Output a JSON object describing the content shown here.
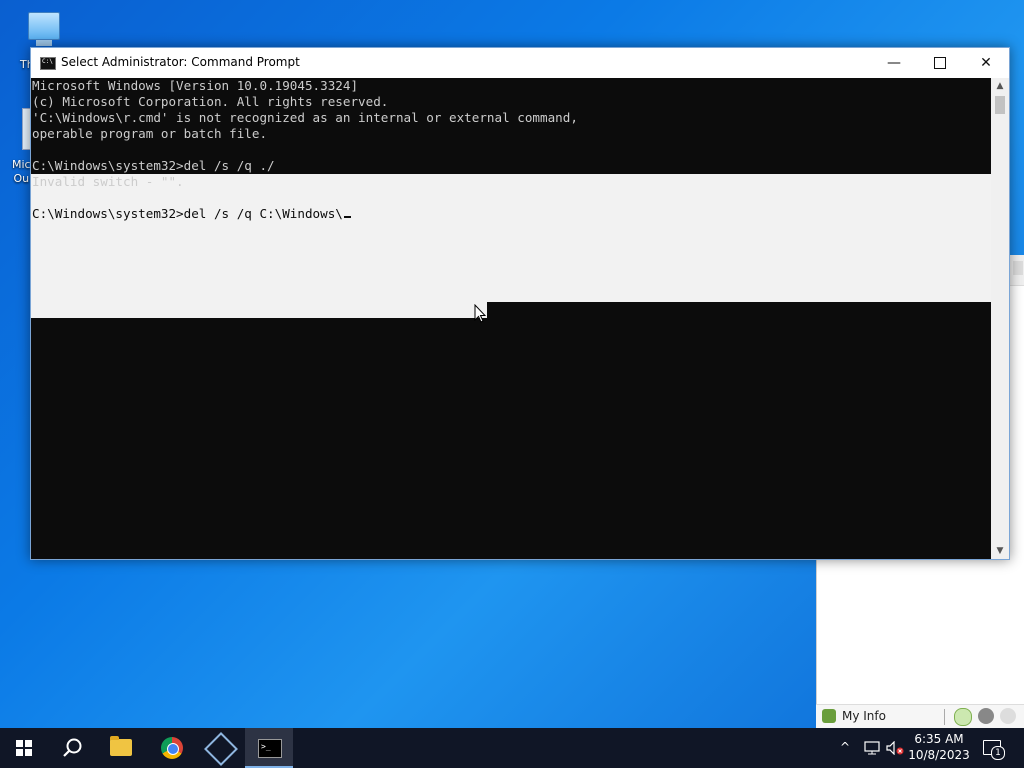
{
  "desktop": {
    "icons": [
      {
        "label": "Th"
      },
      {
        "label": "Mic\nOu"
      }
    ]
  },
  "side_panel": {
    "footer_label": "My Info"
  },
  "window": {
    "title": "Select Administrator: Command Prompt",
    "minimize": "—",
    "close": "✕"
  },
  "console": {
    "lines": [
      "Microsoft Windows [Version 10.0.19045.3324]",
      "(c) Microsoft Corporation. All rights reserved.",
      "'C:\\Windows\\r.cmd' is not recognized as an internal or external command,",
      "operable program or batch file.",
      "",
      "C:\\Windows\\system32>del /s /q ./",
      "Invalid switch - \"\".",
      "",
      "C:\\Windows\\system32>del /s /q C:\\Windows\\"
    ]
  },
  "scrollbar": {
    "up_arrow": "▲",
    "down_arrow": "▼"
  },
  "taskbar": {
    "apps": [
      "start-icon",
      "search-icon",
      "file-explorer-icon",
      "chrome-icon",
      "virtualbox-icon",
      "command-prompt-icon"
    ]
  },
  "tray": {
    "up_arrow": "^",
    "time": "6:35 AM",
    "date": "10/8/2023",
    "notifications_count": "1"
  }
}
